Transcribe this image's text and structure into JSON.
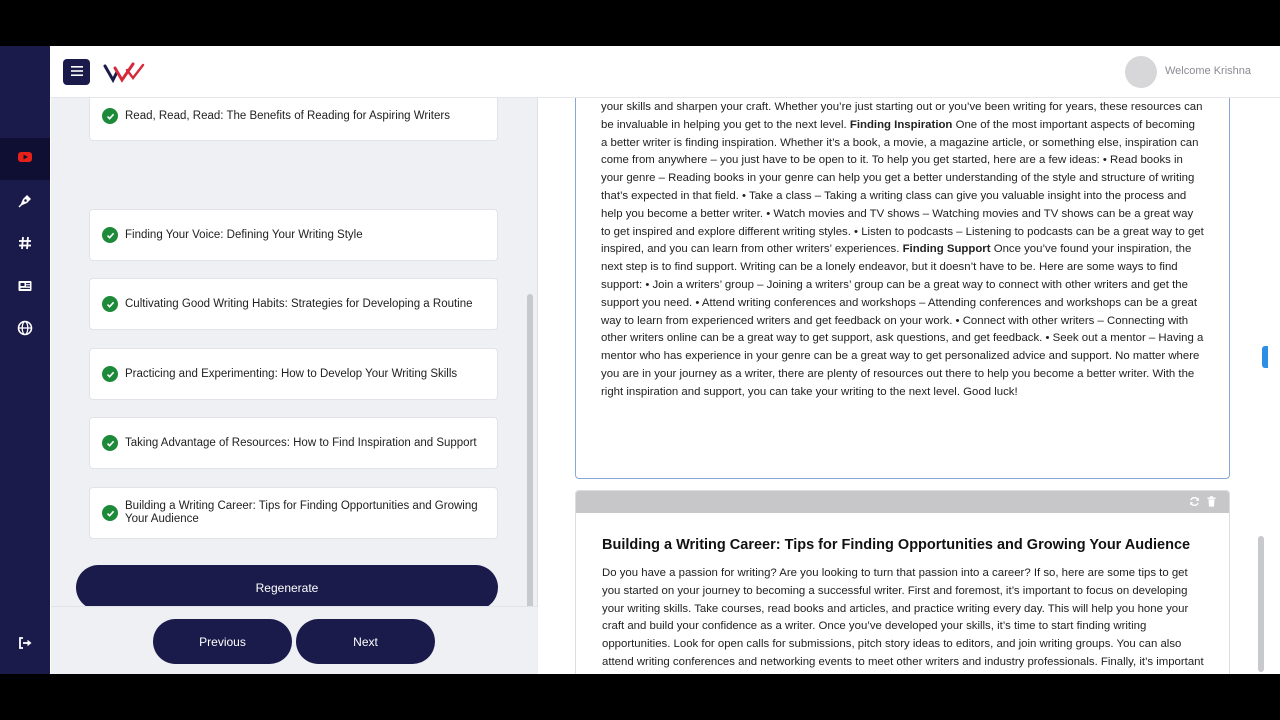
{
  "header": {
    "welcome_text": "Welcome Krishna",
    "menu_icon": "hamburger-icon",
    "logo_icon": "brand-logo"
  },
  "rail": {
    "items": [
      {
        "icon": "youtube-icon",
        "active": true
      },
      {
        "icon": "pen-nib-icon",
        "active": false
      },
      {
        "icon": "hashtag-icon",
        "active": false
      },
      {
        "icon": "newspaper-icon",
        "active": false
      },
      {
        "icon": "globe-icon",
        "active": false
      }
    ],
    "logout_icon": "logout-icon",
    "colors": {
      "bg": "#1b1b4b",
      "active_bg": "#0f0f33",
      "youtube": "#e62117"
    }
  },
  "outline": {
    "items": [
      {
        "label": "Read, Read, Read: The Benefits of Reading for Aspiring Writers"
      },
      {
        "label": "Finding Your Voice: Defining Your Writing Style"
      },
      {
        "label": "Cultivating Good Writing Habits: Strategies for Developing a Routine"
      },
      {
        "label": "Practicing and Experimenting: How to Develop Your Writing Skills"
      },
      {
        "label": "Taking Advantage of Resources: How to Find Inspiration and Support"
      },
      {
        "label": "Building a Writing Career: Tips for Finding Opportunities and Growing Your Audience"
      }
    ],
    "regenerate_label": "Regenerate",
    "check_color": "#1d8a3a"
  },
  "nav": {
    "previous_label": "Previous",
    "next_label": "Next"
  },
  "article1": {
    "p1": "your skills and sharpen your craft. Whether you’re just starting out or you’ve been writing for years, these resources can be invaluable in helping you get to the next level.",
    "h1": "Finding Inspiration",
    "p2": "One of the most important aspects of becoming a better writer is finding inspiration. Whether it’s a book, a movie, a magazine article, or something else, inspiration can come from anywhere – you just have to be open to it. To help you get started, here are a few ideas: • Read books in your genre – Reading books in your genre can help you get a better understanding of the style and structure of writing that’s expected in that field. • Take a class – Taking a writing class can give you valuable insight into the process and help you become a better writer. • Watch movies and TV shows – Watching movies and TV shows can be a great way to get inspired and explore different writing styles. • Listen to podcasts – Listening to podcasts can be a great way to get inspired, and you can learn from other writers’ experiences.",
    "h2": "Finding Support",
    "p3": "Once you’ve found your inspiration, the next step is to find support. Writing can be a lonely endeavor, but it doesn’t have to be. Here are some ways to find support: • Join a writers’ group – Joining a writers’ group can be a great way to connect with other writers and get the support you need. • Attend writing conferences and workshops – Attending conferences and workshops can be a great way to learn from experienced writers and get feedback on your work. • Connect with other writers – Connecting with other writers online can be a great way to get support, ask questions, and get feedback. • Seek out a mentor – Having a mentor who has experience in your genre can be a great way to get personalized advice and support. No matter where you are in your journey as a writer, there are plenty of resources out there to help you become a better writer. With the right inspiration and support, you can take your writing to the next level. Good luck!"
  },
  "article2": {
    "title": "Building a Writing Career: Tips for Finding Opportunities and Growing Your Audience",
    "body": "Do you have a passion for writing? Are you looking to turn that passion into a career? If so, here are some tips to get you started on your journey to becoming a successful writer. First and foremost, it’s important to focus on developing your writing skills. Take courses, read books and articles, and practice writing every day. This will help you hone your craft and build your confidence as a writer. Once you’ve developed your skills, it’s time to start finding writing opportunities. Look for open calls for submissions, pitch story ideas to editors, and join writing groups. You can also attend writing conferences and networking events to meet other writers and industry professionals. Finally, it’s important to build your online presence. Create a website and social media profiles to showcase your writing and find new opportunities. You can also use these platforms to build an audience and connect with other writers. Don’t be discouraged if you don’t see immediate results. Building a successful writing",
    "refresh_icon": "refresh-icon",
    "delete_icon": "trash-icon"
  }
}
